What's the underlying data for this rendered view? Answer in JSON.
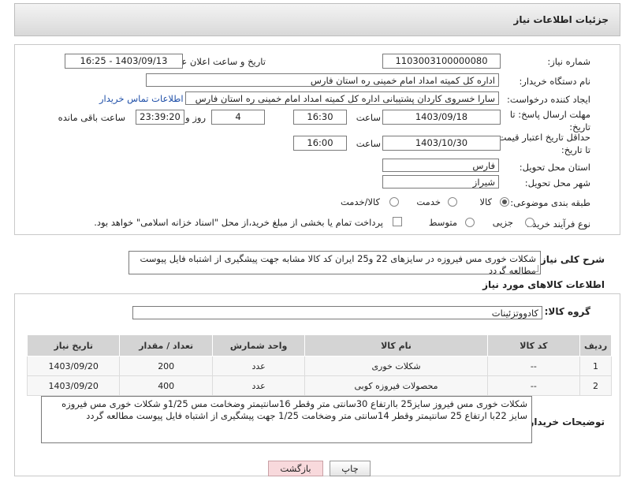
{
  "header": {
    "title": "جزئیات اطلاعات نیاز"
  },
  "fields": {
    "need_number_label": "شماره نیاز:",
    "need_number": "1103003100000080",
    "announce_label": "تاریخ و ساعت اعلان عمومی:",
    "announce_value": "1403/09/13 - 16:25",
    "buyer_org_label": "نام دستگاه خریدار:",
    "buyer_org": "اداره کل کمیته امداد امام خمینی  ره  استان فارس",
    "requester_label": "ایجاد کننده درخواست:",
    "requester": "سارا خسروی کاردان پشتیبانی  اداره کل کمیته امداد امام خمینی  ره  استان فارس",
    "contact_link": "اطلاعات تماس خریدار",
    "reply_deadline_label": "مهلت ارسال پاسخ: تا تاریخ:",
    "reply_date": "1403/09/18",
    "time_label": "ساعت",
    "reply_time": "16:30",
    "days_value": "4",
    "days_label": "روز و",
    "remaining_time": "23:39:20",
    "remaining_label": "ساعت باقی مانده",
    "price_validity_label": "حداقل تاریخ اعتبار قیمت: تا تاریخ:",
    "price_date": "1403/10/30",
    "price_time": "16:00",
    "province_label": "استان محل تحویل:",
    "province": "فارس",
    "city_label": "شهر محل تحویل:",
    "city": "شیراز",
    "category_label": "طبقه بندی موضوعی:",
    "category_options": [
      "کالا",
      "خدمت",
      "کالا/خدمت"
    ],
    "process_label": "نوع فرآیند خرید :",
    "process_options": [
      "جزیی",
      "متوسط"
    ],
    "payment_note": "پرداخت تمام یا بخشی از مبلغ خرید،از محل \"اسناد خزانه اسلامی\" خواهد بود."
  },
  "summary": {
    "label": "شرح کلی نیاز:",
    "text": "شکلات خوری مس فیروزه در سایزهای 22 و25 ایران کد کالا مشابه جهت پیشگیری از اشتباه فایل پیوست مطالعه گردد"
  },
  "goods": {
    "section_title": "اطلاعات کالاهای مورد نیاز",
    "group_label": "گروه کالا:",
    "group_value": "کادووتزئینات",
    "columns": [
      "ردیف",
      "کد کالا",
      "نام کالا",
      "واحد شمارش",
      "تعداد / مقدار",
      "تاریخ نیاز"
    ],
    "rows": [
      [
        "1",
        "--",
        "شکلات خوری",
        "عدد",
        "200",
        "1403/09/20"
      ],
      [
        "2",
        "--",
        "محصولات فیروزه کوبی",
        "عدد",
        "400",
        "1403/09/20"
      ]
    ]
  },
  "buyer_notes": {
    "label": "توضیحات خریدار:",
    "text": "شکلات خوری مس فیروز سایز25 باارتفاع 30سانتی متر وقطر 16سانتیمتر وضخامت مس 1/25و شکلات خوری مس فیروزه سایز 22با ارتفاع 25 سانتیمتر وقطر 14سانتی متر وضخامت 1/25 جهت پیشگیری از اشتباه فایل پیوست مطالعه گردد"
  },
  "buttons": {
    "print": "چاپ",
    "back": "بازگشت"
  }
}
